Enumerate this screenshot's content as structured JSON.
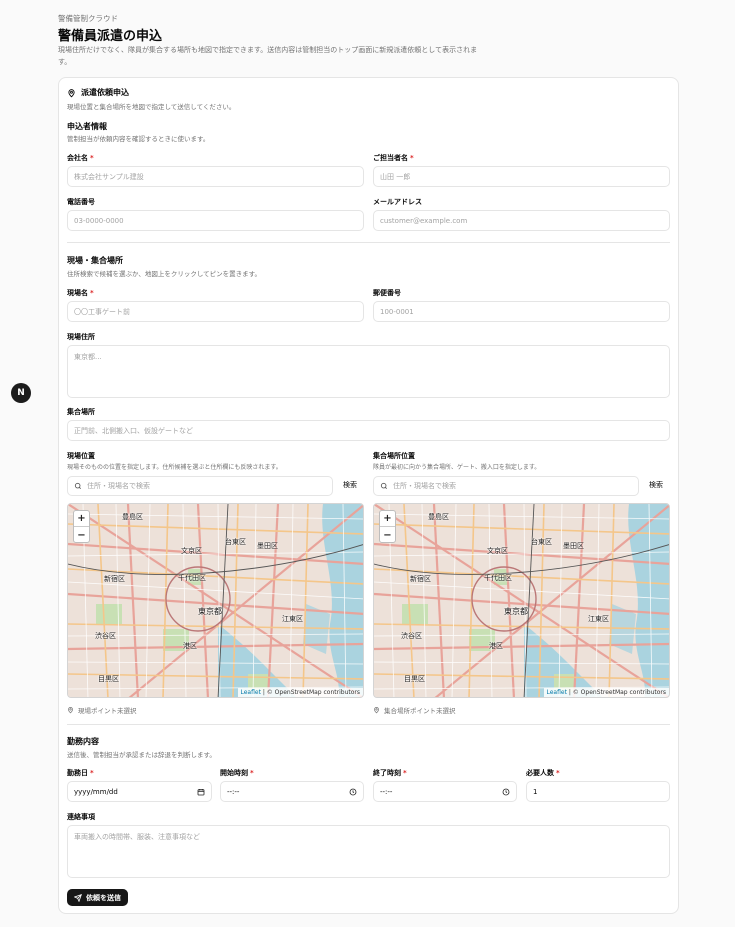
{
  "page": {
    "brand": "警備管制クラウド",
    "title": "警備員派遣の申込",
    "description": "現場住所だけでなく、隊員が集合する場所も地図で指定できます。送信内容は管制担当のトップ画面に新規派遣依頼として表示されます。",
    "badge": "N"
  },
  "card": {
    "title": "派遣依頼申込",
    "subtitle": "現場位置と集合場所を地図で指定して送信してください。"
  },
  "applicant": {
    "heading": "申込者情報",
    "note": "管制担当が依頼内容を確認するときに使います。",
    "company_label": "会社名",
    "company_placeholder": "株式会社サンプル建設",
    "contact_label": "ご担当者名",
    "contact_placeholder": "山田 一郎",
    "phone_label": "電話番号",
    "phone_placeholder": "03-0000-0000",
    "email_label": "メールアドレス",
    "email_placeholder": "customer@example.com"
  },
  "site": {
    "heading": "現場・集合場所",
    "note": "住所検索で候補を選ぶか、地図上をクリックしてピンを置きます。",
    "name_label": "現場名",
    "name_placeholder": "〇〇工事ゲート前",
    "postal_label": "郵便番号",
    "postal_placeholder": "100-0001",
    "address_label": "現場住所",
    "address_placeholder": "東京都...",
    "meeting_label": "集合場所",
    "meeting_placeholder": "正門前、北側搬入口、仮設ゲートなど",
    "site_loc_label": "現場位置",
    "site_loc_note": "現場そのものの位置を指定します。住所候補を選ぶと住所欄にも反映されます。",
    "meet_loc_label": "集合場所位置",
    "meet_loc_note": "隊員が最初に向かう集合場所、ゲート、搬入口を指定します。",
    "search_placeholder": "住所・現場名で検索",
    "search_button": "検索",
    "site_pin_status": "現場ポイント未選択",
    "meet_pin_status": "集合場所ポイント未選択"
  },
  "map": {
    "zoom_in": "+",
    "zoom_out": "−",
    "attribution_leaflet": "Leaflet",
    "attribution_osm": " | © OpenStreetMap contributors",
    "labels": [
      "豊島区",
      "文京区",
      "台東区",
      "墨田区",
      "新宿区",
      "千代田区",
      "東京都",
      "渋谷区",
      "江東区",
      "港区",
      "目黒区"
    ]
  },
  "work": {
    "heading": "勤務内容",
    "note": "送信後、管制担当が承認または辞退を判断します。",
    "date_label": "勤務日",
    "date_placeholder": "yyyy/mm/dd",
    "start_label": "開始時刻",
    "start_placeholder": "--:--",
    "end_label": "終了時刻",
    "end_placeholder": "--:--",
    "headcount_label": "必要人数",
    "headcount_value": "1",
    "notes_label": "連絡事項",
    "notes_placeholder": "車両搬入の時間帯、服装、注意事項など"
  },
  "submit_label": "依頼を送信",
  "colors": {
    "accent": "#171717",
    "required": "#dc2626",
    "muted": "#737373",
    "border": "#e5e5e5"
  }
}
